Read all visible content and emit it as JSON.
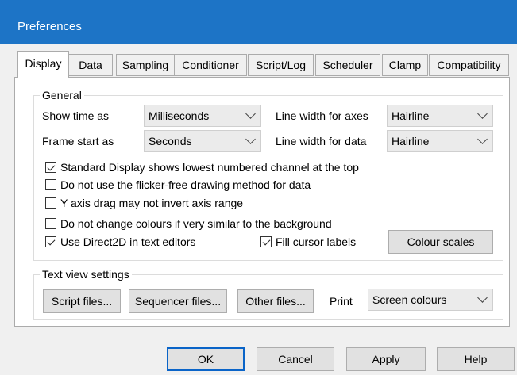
{
  "window": {
    "title": "Preferences"
  },
  "tabs": [
    "Display",
    "Data",
    "Sampling",
    "Conditioner",
    "Script/Log",
    "Scheduler",
    "Clamp",
    "Compatibility"
  ],
  "general": {
    "label": "General",
    "show_time_as_label": "Show time as",
    "show_time_as_value": "Milliseconds",
    "frame_start_as_label": "Frame start as",
    "frame_start_as_value": "Seconds",
    "line_width_axes_label": "Line width for axes",
    "line_width_axes_value": "Hairline",
    "line_width_data_label": "Line width for data",
    "line_width_data_value": "Hairline",
    "checkboxes": [
      {
        "label": "Standard Display shows lowest numbered channel at the top",
        "checked": true
      },
      {
        "label": "Do not use the flicker-free drawing method for data",
        "checked": false
      },
      {
        "label": "Y axis drag may not invert axis range",
        "checked": false
      },
      {
        "label": "Do not change colours if very similar to the background",
        "checked": false
      },
      {
        "label": "Use Direct2D in text editors",
        "checked": true
      }
    ],
    "fill_cursor_labels": {
      "label": "Fill cursor labels",
      "checked": true
    },
    "colour_scales_label": "Colour scales"
  },
  "text_view": {
    "label": "Text view settings",
    "script_files_label": "Script files...",
    "sequencer_files_label": "Sequencer files...",
    "other_files_label": "Other files...",
    "print_label": "Print",
    "print_value": "Screen colours"
  },
  "footer": {
    "ok_label": "OK",
    "cancel_label": "Cancel",
    "apply_label": "Apply",
    "help_label": "Help"
  },
  "colors": {
    "titlebar": "#1d74c6",
    "default_button_border": "#0a64c8"
  }
}
